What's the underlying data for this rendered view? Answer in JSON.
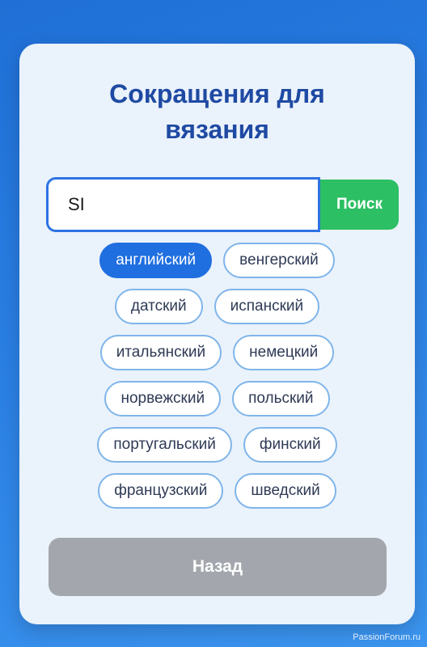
{
  "page": {
    "title": "Сокращения для\nвязания"
  },
  "search": {
    "value": "SI",
    "button_label": "Поиск"
  },
  "languages": {
    "rows": [
      [
        {
          "label": "английский",
          "selected": true
        },
        {
          "label": "венгерский",
          "selected": false
        }
      ],
      [
        {
          "label": "датский",
          "selected": false
        },
        {
          "label": "испанский",
          "selected": false
        }
      ],
      [
        {
          "label": "итальянский",
          "selected": false
        },
        {
          "label": "немецкий",
          "selected": false
        }
      ],
      [
        {
          "label": "норвежский",
          "selected": false
        },
        {
          "label": "польский",
          "selected": false
        }
      ],
      [
        {
          "label": "португальский",
          "selected": false
        },
        {
          "label": "финский",
          "selected": false
        }
      ],
      [
        {
          "label": "французский",
          "selected": false
        },
        {
          "label": "шведский",
          "selected": false
        }
      ]
    ]
  },
  "footer": {
    "back_label": "Назад"
  },
  "watermark": "PassionForum.ru",
  "colors": {
    "accent": "#1f6fe0",
    "search_button": "#2cbf63",
    "title": "#1f4aa3",
    "back_button": "#a3a7ad"
  }
}
